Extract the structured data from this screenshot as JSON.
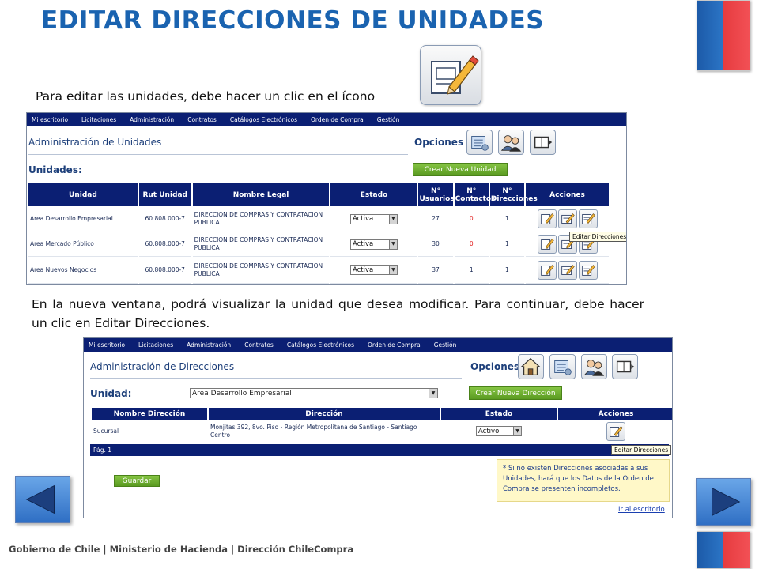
{
  "slide": {
    "title": "EDITAR DIRECCIONES DE UNIDADES",
    "instruction_1": "Para editar las unidades, debe hacer un clic en el ícono",
    "instruction_2": "En la nueva ventana, podrá visualizar la unidad que desea modificar. Para continuar, debe hacer un clic en Editar Direcciones.",
    "footer": "Gobierno de Chile | Ministerio de Hacienda | Dirección ChileCompra"
  },
  "colors": {
    "title_blue": "#1a63b0",
    "nav_dark": "#0b1f73",
    "green_button": "#6aae2f",
    "flag_blue": "#1c5aa8",
    "flag_red": "#e63b3f",
    "notice_bg": "#fff8c8"
  },
  "icons": {
    "big_icon": "edit-pencil-icon",
    "prev_nav": "prev-triangle-icon",
    "next_nav": "next-triangle-icon"
  },
  "nav_menu": [
    "Mi escritorio",
    "Licitaciones",
    "Administración",
    "Contratos",
    "Catálogos Electrónicos",
    "Orden de Compra",
    "Gestión"
  ],
  "units_screen": {
    "title": "Administración de Unidades",
    "options_label": "Opciones",
    "units_label": "Unidades:",
    "create_button": "Crear Nueva Unidad",
    "columns": [
      "Unidad",
      "Rut Unidad",
      "Nombre Legal",
      "Estado",
      "N° Usuarios",
      "N° Contactos",
      "N° Direcciones",
      "Acciones"
    ],
    "rows": [
      {
        "unidad": "Area Desarrollo Empresarial",
        "rut": "60.808.000-7",
        "nombre_legal": "DIRECCION DE COMPRAS Y CONTRATACION PUBLICA",
        "estado": "Activa",
        "usuarios": "27",
        "contactos": "0",
        "direcciones": "1"
      },
      {
        "unidad": "Area Mercado Público",
        "rut": "60.808.000-7",
        "nombre_legal": "DIRECCION DE COMPRAS Y CONTRATACION PUBLICA",
        "estado": "Activa",
        "usuarios": "30",
        "contactos": "0",
        "direcciones": "1"
      },
      {
        "unidad": "Area Nuevos Negocios",
        "rut": "60.808.000-7",
        "nombre_legal": "DIRECCION DE COMPRAS Y CONTRATACION PUBLICA",
        "estado": "Activa",
        "usuarios": "37",
        "contactos": "1",
        "direcciones": "1"
      }
    ],
    "tooltip": "Editar Direcciones"
  },
  "addresses_screen": {
    "title": "Administración de Direcciones",
    "options_label": "Opciones",
    "unit_label": "Unidad:",
    "unit_value": "Area Desarrollo Empresarial",
    "create_button": "Crear Nueva Dirección",
    "columns": [
      "Nombre Dirección",
      "Dirección",
      "Estado",
      "Acciones"
    ],
    "rows": [
      {
        "nombre": "Sucursal",
        "direccion": "Monjitas 392, 8vo. Piso - Región Metropolitana de Santiago - Santiago Centro",
        "estado": "Activo"
      }
    ],
    "tooltip": "Editar Direcciones",
    "pagination": "Pág.   1",
    "save_button": "Guardar",
    "notice": "* Si no existen Direcciones asociadas a sus Unidades, hará que los Datos de la Orden de Compra se presenten incompletos.",
    "desk_link": "Ir al escritorio"
  }
}
